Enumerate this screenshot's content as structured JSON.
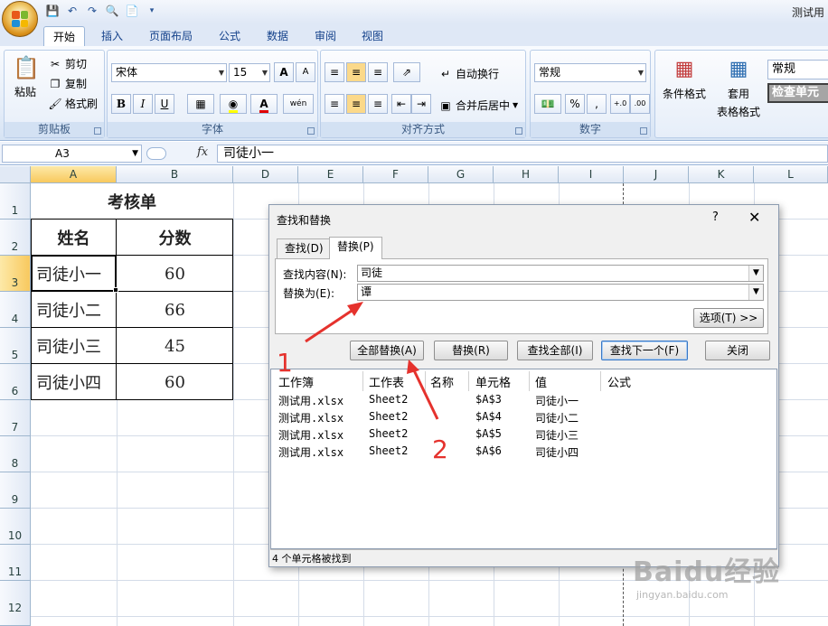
{
  "window": {
    "title": "测试用"
  },
  "ribbon": {
    "tabs": [
      "开始",
      "插入",
      "页面布局",
      "公式",
      "数据",
      "审阅",
      "视图"
    ],
    "active_tab": "开始",
    "clipboard": {
      "label": "剪贴板",
      "paste": "粘贴",
      "cut": "剪切",
      "copy": "复制",
      "format_painter": "格式刷"
    },
    "font": {
      "label": "字体",
      "name": "宋体",
      "size": "15",
      "bold": "B",
      "italic": "I",
      "underline": "U",
      "grow": "A",
      "shrink": "A",
      "font_color": "A",
      "phonetic": "wén"
    },
    "alignment": {
      "label": "对齐方式",
      "wrap": "自动换行",
      "merge": "合并后居中"
    },
    "number": {
      "label": "数字",
      "format": "常规",
      "percent": "%",
      "comma": ",",
      "inc_decimal": "+.0",
      "dec_decimal": ".00"
    },
    "styles": {
      "conditional": "条件格式",
      "table_format_line1": "套用",
      "table_format_line2": "表格格式",
      "style_normal": "常规",
      "style_check": "检查单元"
    }
  },
  "formula_bar": {
    "name_box": "A3",
    "fx": "fx",
    "content": "司徒小一"
  },
  "sheet": {
    "columns": [
      "A",
      "B",
      "D",
      "E",
      "F",
      "G",
      "H",
      "I",
      "J",
      "K",
      "L"
    ],
    "rows": [
      "1",
      "2",
      "3",
      "4",
      "5",
      "6",
      "7",
      "8",
      "9",
      "10",
      "11",
      "12"
    ],
    "title": "考核单",
    "header_name": "姓名",
    "header_score": "分数",
    "records": [
      {
        "name": "司徒小一",
        "score": "60"
      },
      {
        "name": "司徒小二",
        "score": "66"
      },
      {
        "name": "司徒小三",
        "score": "45"
      },
      {
        "name": "司徒小四",
        "score": "60"
      }
    ]
  },
  "dialog": {
    "title": "查找和替换",
    "help": "?",
    "close": "✕",
    "tab_find": "查找(D)",
    "tab_replace": "替换(P)",
    "find_label": "查找内容(N):",
    "find_value": "司徒",
    "replace_label": "替换为(E):",
    "replace_value": "谭",
    "options_button": "选项(T) >>",
    "replace_all_button": "全部替换(A)",
    "replace_button": "替换(R)",
    "find_all_button": "查找全部(I)",
    "find_next_button": "查找下一个(F)",
    "close_button": "关闭",
    "result_columns": [
      "工作簿",
      "工作表",
      "名称",
      "单元格",
      "值",
      "公式"
    ],
    "results": [
      {
        "book": "测试用.xlsx",
        "sheet": "Sheet2",
        "name": "",
        "cell": "$A$3",
        "value": "司徒小一",
        "formula": ""
      },
      {
        "book": "测试用.xlsx",
        "sheet": "Sheet2",
        "name": "",
        "cell": "$A$4",
        "value": "司徒小二",
        "formula": ""
      },
      {
        "book": "测试用.xlsx",
        "sheet": "Sheet2",
        "name": "",
        "cell": "$A$5",
        "value": "司徒小三",
        "formula": ""
      },
      {
        "book": "测试用.xlsx",
        "sheet": "Sheet2",
        "name": "",
        "cell": "$A$6",
        "value": "司徒小四",
        "formula": ""
      }
    ],
    "status": "4 个单元格被找到"
  },
  "annotations": {
    "step1": "1",
    "step2": "2",
    "color": "#e5322d"
  },
  "watermark": {
    "brand": "Baidu经验",
    "url": "jingyan.baidu.com"
  },
  "colors": {
    "accent": "#15428b",
    "ribbon_bg": "#dfe8f6",
    "selection": "#f8c95e"
  }
}
